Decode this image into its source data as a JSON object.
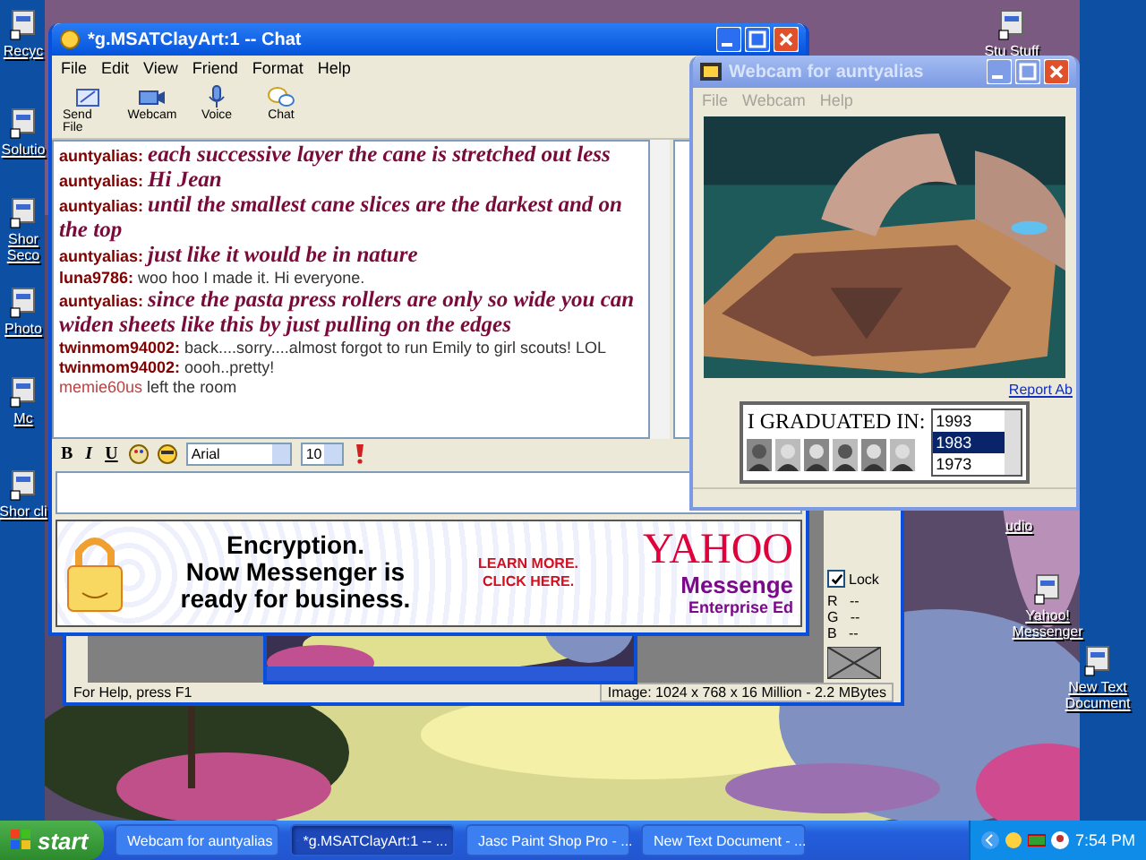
{
  "desktop": {
    "kind": "picture",
    "icons_left": [
      {
        "label": "Recyc"
      },
      {
        "label": "Solutio"
      },
      {
        "label": "Shor Seco"
      },
      {
        "label": "Photo"
      },
      {
        "label": "Mc"
      },
      {
        "label": "Shor cli"
      }
    ],
    "icons_right": [
      {
        "label": "Stu Stuff"
      },
      {
        "label": "udio"
      },
      {
        "label": "Yahoo! Messenger"
      },
      {
        "label": "New Text Document"
      }
    ]
  },
  "paint_window": {
    "status": "For Help, press F1",
    "image_info": "Image:  1024 x 768 x 16 Million - 2.2 MBytes",
    "lock": {
      "label": "Lock",
      "checked": true
    },
    "rgb_readouts": [
      "R   --",
      "G   --",
      "B   --"
    ]
  },
  "chat_window": {
    "title": "*g.MSATClayArt:1 -- Chat",
    "active": true,
    "menu": [
      "File",
      "Edit",
      "View",
      "Friend",
      "Format",
      "Help"
    ],
    "toolbar": [
      "Send File",
      "Webcam",
      "Voice",
      "Chat"
    ],
    "messages": [
      {
        "kind": "styled",
        "user": "auntyalias:",
        "text": "each successive layer the cane is stretched out less"
      },
      {
        "kind": "styled",
        "user": "auntyalias:",
        "text": "Hi Jean"
      },
      {
        "kind": "styled",
        "user": "auntyalias:",
        "text": "until the smallest cane slices are the darkest and on the top"
      },
      {
        "kind": "styled",
        "user": "auntyalias:",
        "text": "just like it would be in nature"
      },
      {
        "kind": "plain",
        "user": "luna9786:",
        "text": "woo hoo I made it. Hi everyone."
      },
      {
        "kind": "styled",
        "user": "auntyalias:",
        "text": "since the pasta press rollers are only so wide you can widen sheets like this by just pulling on the edges"
      },
      {
        "kind": "plain",
        "user": "twinmom94002:",
        "text": "back....sorry....almost forgot to run Emily to girl scouts! LOL"
      },
      {
        "kind": "plain",
        "user": "twinmom94002:",
        "text": "oooh..pretty!"
      },
      {
        "kind": "event",
        "user": "memie60us",
        "text": "left the room"
      }
    ],
    "format_bar": {
      "styles": [
        "B",
        "I",
        "U"
      ],
      "font": "Arial",
      "size": "10"
    },
    "ad": {
      "headline": [
        "Encryption.",
        "Now Messenger is",
        "ready for business."
      ],
      "link": [
        "LEARN MORE.",
        "CLICK HERE."
      ],
      "brand": "YAHOO",
      "product": "Messenge",
      "edition": "Enterprise Ed"
    }
  },
  "webcam_window": {
    "title": "Webcam for auntyalias",
    "active": false,
    "menu": [
      "File",
      "Webcam",
      "Help"
    ],
    "video": {
      "kind": "picture"
    },
    "report_link": "Report Ab",
    "ad": {
      "text": "I GRADUATED IN:",
      "years": [
        {
          "label": "1993",
          "selected": false
        },
        {
          "label": "1983",
          "selected": true
        },
        {
          "label": "1973",
          "selected": false
        }
      ]
    }
  },
  "taskbar": {
    "start": "start",
    "tasks": [
      {
        "label": "Webcam for auntyalias",
        "selected": false
      },
      {
        "label": "*g.MSATClayArt:1 -- ...",
        "selected": true
      },
      {
        "label": "Jasc Paint Shop Pro - ...",
        "selected": false
      },
      {
        "label": "New Text Document - ...",
        "selected": false
      }
    ],
    "clock": "7:54 PM"
  }
}
